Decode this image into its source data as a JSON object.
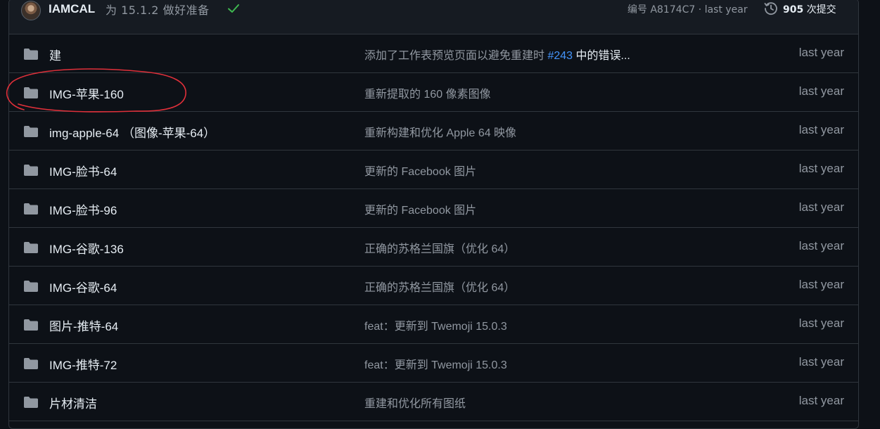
{
  "commit": {
    "author": "IAMCAL",
    "message": "为 15.1.2 做好准备",
    "hash_label": "编号 A8174C7 · last year",
    "count": "905",
    "count_suffix": "次提交"
  },
  "rows": [
    {
      "name": "建",
      "message": "添加了工作表预览页面以避免重建时",
      "link": "#243",
      "message_rest": "中的错误...",
      "date": "last year"
    },
    {
      "name": "IMG-苹果-160",
      "message": "重新提取的 160 像素图像",
      "date": "last year"
    },
    {
      "name": "img-apple-64 （图像-苹果-64）",
      "message": "重新构建和优化 Apple 64 映像",
      "date": "last year"
    },
    {
      "name": "IMG-脸书-64",
      "message": "更新的 Facebook 图片",
      "date": "last year"
    },
    {
      "name": "IMG-脸书-96",
      "message": "更新的 Facebook 图片",
      "date": "last year"
    },
    {
      "name": "IMG-谷歌-136",
      "message": "正确的苏格兰国旗（优化 64）",
      "date": "last year"
    },
    {
      "name": "IMG-谷歌-64",
      "message": "正确的苏格兰国旗（优化 64）",
      "date": "last year"
    },
    {
      "name": "图片-推特-64",
      "message": "feat：更新到 Twemoji 15.0.3",
      "date": "last year"
    },
    {
      "name": "IMG-推特-72",
      "message": "feat：更新到 Twemoji 15.0.3",
      "date": "last year"
    },
    {
      "name": "片材清洁",
      "message": "重建和优化所有图纸",
      "date": "last year"
    }
  ],
  "colors": {
    "background": "#0d1117",
    "header": "#161b22",
    "border": "#30363d",
    "muted_text": "#9198a1",
    "link": "#4493f8",
    "success": "#3fb950",
    "annotation": "#e0303a"
  },
  "icons": {
    "folder": "folder-icon",
    "check": "check-icon",
    "history": "history-icon"
  }
}
